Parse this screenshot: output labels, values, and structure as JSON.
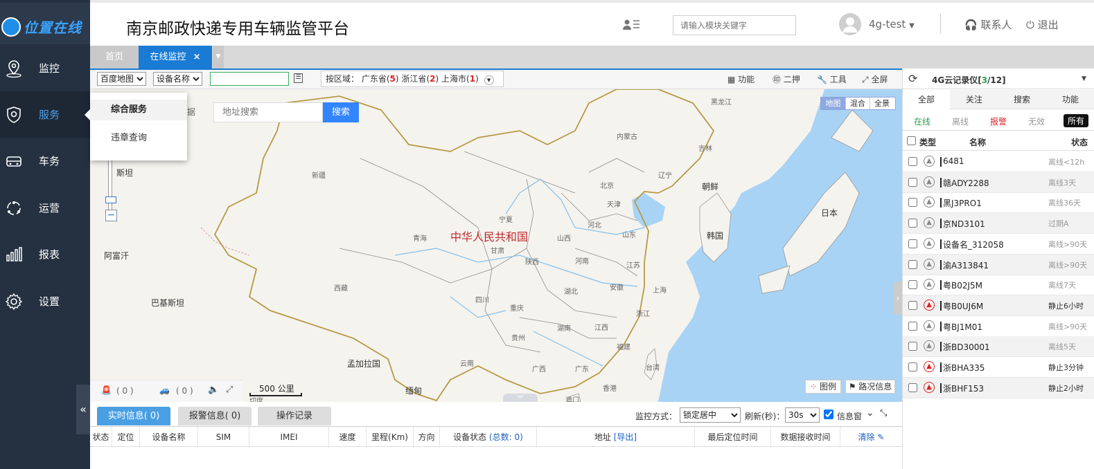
{
  "logo": {
    "text": "位置在线"
  },
  "sidebar": {
    "items": [
      {
        "label": "监控"
      },
      {
        "label": "服务"
      },
      {
        "label": "车务"
      },
      {
        "label": "运营"
      },
      {
        "label": "报表"
      },
      {
        "label": "设置"
      }
    ]
  },
  "header": {
    "title": "南京邮政快递专用车辆监管平台",
    "search_placeholder": "请输入模块关键字",
    "user": "4g-test",
    "contact": "联系人",
    "logout": "退出"
  },
  "tabs": {
    "home": "首页",
    "monitor": "在线监控",
    "close": "×"
  },
  "toolbar": {
    "map_type": "百度地图",
    "device_field": "设备名称",
    "region_prefix": "按区域：",
    "regions": [
      {
        "name": "广东省",
        "count": "5"
      },
      {
        "name": "浙江省",
        "count": "2"
      },
      {
        "name": "上海市",
        "count": "1"
      }
    ],
    "function": "功能",
    "erya": "二押",
    "tools": "工具",
    "fullscreen": "全屏"
  },
  "service_menu": {
    "items": [
      "综合服务",
      "违章查询"
    ]
  },
  "map": {
    "search_placeholder": "地址搜索",
    "search_button": "搜索",
    "type_buttons": [
      "地图",
      "混合",
      "全景"
    ],
    "country_label": "中华人民共和国",
    "labels": {
      "heilongjiang": "黑龙江",
      "neimenggu": "内蒙古",
      "jilin": "吉林",
      "liaoning": "辽宁",
      "xinjiang": "新疆",
      "gansu": "甘肃",
      "ningxia": "宁夏",
      "beijing": "北京",
      "tianjin": "天津",
      "hebei": "河北",
      "shanxi": "山西",
      "shandong": "山东",
      "qinghai": "青海",
      "shaanxi": "陕西",
      "henan": "河南",
      "jiangsu": "江苏",
      "shanghai": "上海",
      "anhui": "安徽",
      "hubei": "湖北",
      "xizang": "西藏",
      "sichuan": "四川",
      "chongqing": "重庆",
      "zhejiang": "浙江",
      "hunan": "湖南",
      "jiangxi": "江西",
      "guizhou": "贵州",
      "fujian": "福建",
      "yunnan": "云南",
      "guangxi": "广西",
      "guangdong": "广东",
      "taiwan": "台湾",
      "xianggang": "香港",
      "aomen": "澳门",
      "chaoxian": "朝鲜",
      "hanguo": "韩国",
      "riben": "日本",
      "afuhan": "阿富汗",
      "bajisitan": "巴基斯坦",
      "mengjiala": "孟加拉国",
      "miandian": "缅甸",
      "sitan": "斯坦",
      "ju": "据",
      "budan": "切度"
    },
    "alarm_count": "( 0 )",
    "vehicle_count": "( 0 )",
    "scale": "500 公里",
    "legend": "图例",
    "traffic": "路况信息"
  },
  "right_panel": {
    "title_prefix": "4G云记录仪[",
    "online": "3",
    "total": "/12]",
    "tabs": [
      "全部",
      "关注",
      "搜索",
      "功能"
    ],
    "filters": [
      "在线",
      "离线",
      "报警",
      "无效",
      "所有"
    ],
    "headers": {
      "type": "类型",
      "name": "名称",
      "status": "状态"
    },
    "rows": [
      {
        "name": "6481",
        "status": "离线<12h",
        "alarm": false
      },
      {
        "name": "赣ADY2288",
        "status": "离线3天",
        "alarm": false
      },
      {
        "name": "黑J3PRO1",
        "status": "离线36天",
        "alarm": false
      },
      {
        "name": "京ND3101",
        "status": "过期A",
        "alarm": false
      },
      {
        "name": "设备名_312058",
        "status": "离线>90天",
        "alarm": false
      },
      {
        "name": "渝A313841",
        "status": "离线>90天",
        "alarm": false
      },
      {
        "name": "粤B02J5M",
        "status": "离线7天",
        "alarm": false
      },
      {
        "name": "粤B0UJ6M",
        "status": "静止6小时",
        "alarm": true
      },
      {
        "name": "粤BJ1M01",
        "status": "离线>90天",
        "alarm": false
      },
      {
        "name": "浙BD30001",
        "status": "离线5天",
        "alarm": false
      },
      {
        "name": "浙BHA335",
        "status": "静止3分钟",
        "alarm": true
      },
      {
        "name": "浙BHF153",
        "status": "静止2小时",
        "alarm": true
      }
    ]
  },
  "bottom": {
    "tabs": [
      "实时信息( 0)",
      "报警信息( 0)",
      "操作记录"
    ],
    "monitor_mode_label": "监控方式：",
    "monitor_mode": "锁定居中",
    "refresh_label": "刷新(秒)：",
    "refresh": "30s",
    "info_window": "信息窗",
    "collapse": "«",
    "columns": {
      "status": "状态",
      "locate": "定位",
      "device_name": "设备名称",
      "sim": "SIM",
      "imei": "IMEI",
      "speed": "速度",
      "mileage": "里程(Km)",
      "direction": "方向",
      "device_status": "设备状态",
      "total": "(总数: 0)",
      "address": "地址",
      "export": "[导出]",
      "last_locate": "最后定位时间",
      "receive_time": "数据接收时间",
      "clear": "清除"
    }
  },
  "colors": {
    "sidebar": "#253141",
    "accent": "#1a7bd4",
    "tab_active": "#1a7bd4",
    "alarm": "#e02020",
    "water": "#a8d3f5"
  }
}
